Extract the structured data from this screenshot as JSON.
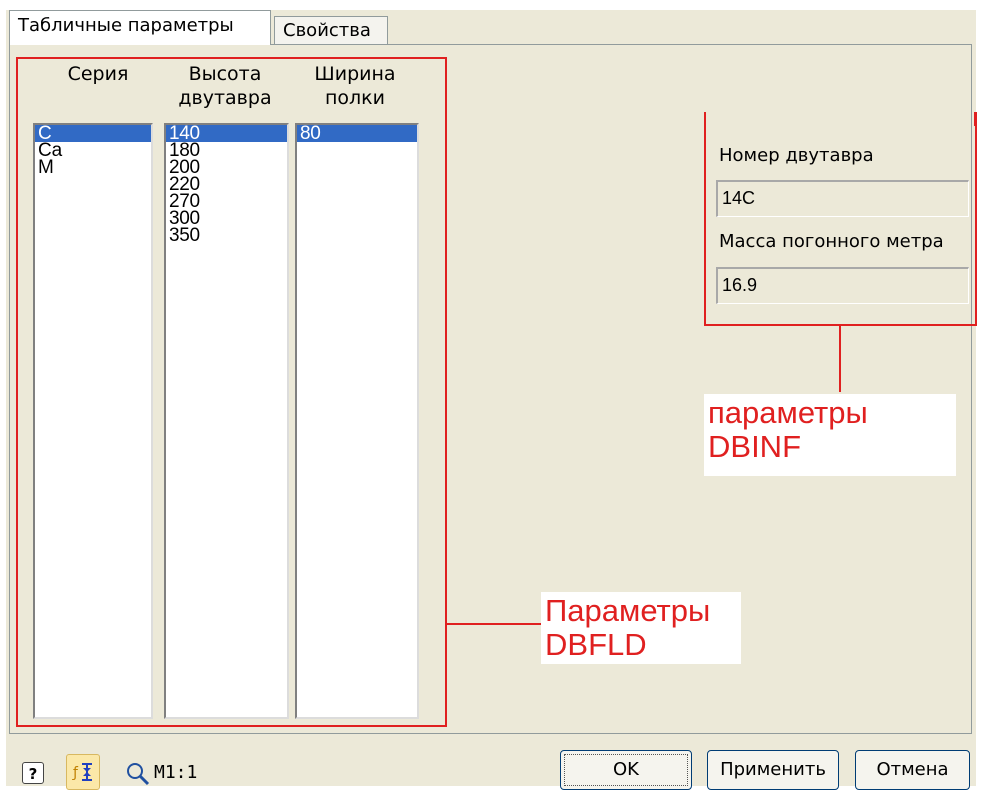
{
  "tabs": [
    {
      "label": "Табличные параметры",
      "active": true
    },
    {
      "label": "Свойства",
      "active": false
    }
  ],
  "columns": [
    {
      "header": "Серия",
      "items": [
        "С",
        "Са",
        "М"
      ],
      "selected": 0
    },
    {
      "header": "Высота двутавра",
      "items": [
        "140",
        "180",
        "200",
        "220",
        "270",
        "300",
        "350"
      ],
      "selected": 0
    },
    {
      "header": "Ширина полки",
      "items": [
        "80"
      ],
      "selected": 0
    }
  ],
  "info": {
    "number_label": "Номер двутавра",
    "number_value": "14С",
    "mass_label": "Масса погонного метра",
    "mass_value": "16.9"
  },
  "annotations": {
    "dbinf_line1": "параметры",
    "dbinf_line2": "DBINF",
    "dbfld_line1": "Параметры",
    "dbfld_line2": "DBFLD",
    "color": "#e02020"
  },
  "toolbar": {
    "help_icon": "help-icon",
    "level_icon": "level-icon",
    "zoom_icon": "magnifier-icon",
    "scale_label": "М1:1"
  },
  "buttons": {
    "ok": "OK",
    "apply": "Применить",
    "cancel": "Отмена"
  },
  "colors": {
    "selection": "#316ac5",
    "dialog_bg": "#ece9d8"
  }
}
